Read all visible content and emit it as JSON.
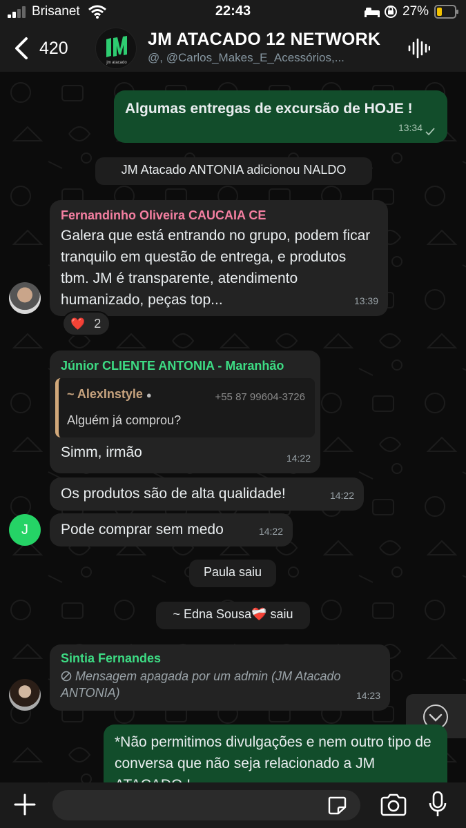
{
  "status_bar": {
    "carrier": "Brisanet",
    "time": "22:43",
    "battery": "27%"
  },
  "header": {
    "back_count": "420",
    "title": "JM ATACADO 12 NETWORK",
    "subtitle": "@, @Carlos_Makes_E_Acessórios,...",
    "avatar_text": "jm atacado"
  },
  "messages": {
    "m1": {
      "text": "Algumas entregas de excursão de HOJE !",
      "time": "13:34"
    },
    "sys1": "JM Atacado ANTONIA adicionou NALDO",
    "m2": {
      "sender": "Fernandinho Oliveira CAUCAIA CE",
      "text": "Galera que está entrando no grupo, podem ficar tranquilo em questão de entrega, e produtos tbm. JM é transparente, atendimento humanizado, peças top...",
      "time": "13:39",
      "reaction_emoji": "❤️",
      "reaction_count": "2"
    },
    "m3": {
      "sender": "Júnior CLIENTE ANTONIA - Maranhão",
      "quote_name": "~ AlexInstyle",
      "quote_phone": "+55 87 99604-3726",
      "quote_text": "Alguém já comprou?",
      "text": "Simm, irmão",
      "time": "14:22"
    },
    "m4": {
      "text": "Os produtos são de alta qualidade!",
      "time": "14:22"
    },
    "m5": {
      "text": "Pode comprar sem medo",
      "time": "14:22",
      "avatar_letter": "J"
    },
    "sys2": "Paula saiu",
    "sys3": "~ Edna Sousa❤️‍🩹 saiu",
    "m6": {
      "sender": "Sintia Fernandes",
      "text": "Mensagem apagada por um admin (JM Atacado ANTONIA)",
      "time": "14:23"
    },
    "m7": {
      "text": "*Não permitimos divulgações e nem outro tipo de conversa que não seja relacionado a JM ATACADO !"
    }
  },
  "input": {
    "placeholder": ""
  },
  "colors": {
    "outgoing_bubble": "#124d2b",
    "incoming_bubble": "#232323",
    "sender_pink": "#f47fa1",
    "sender_green": "#3ddc84",
    "header_bg": "#1b1b1b"
  }
}
